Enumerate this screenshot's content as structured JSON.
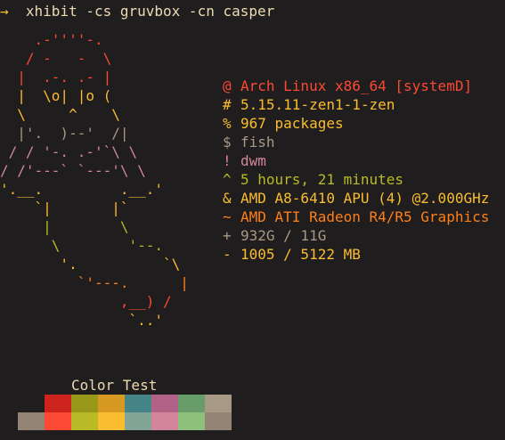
{
  "prompt": {
    "arrow": "→",
    "command": "xhibit -cs gruvbox -cn casper"
  },
  "art": {
    "lines": [
      {
        "text": "    .-''''-.",
        "color": "#fb4934"
      },
      {
        "text": "   / -   -  \\",
        "color": "#fb4934"
      },
      {
        "text": "  |  .-. .- |",
        "color": "#fb4934"
      },
      {
        "text": "  |  \\o| |o (",
        "color": "#fabd2f"
      },
      {
        "text": "  \\     ^    \\",
        "color": "#fabd2f"
      },
      {
        "text": "  |'.  )--'  /|",
        "color": "#a89984"
      },
      {
        "text": " / / '-. .-'`\\ \\",
        "color": "#d3869b"
      },
      {
        "text": "/ /'---` `---'\\ \\",
        "color": "#d3869b"
      },
      {
        "text": "'.__.         .__.'",
        "color": "#fabd2f"
      },
      {
        "text": "    `|       |`",
        "color": "#fabd2f"
      },
      {
        "text": "     |        \\",
        "color": "#b8bb26"
      },
      {
        "text": "      \\        '--.",
        "color": "#b8bb26"
      },
      {
        "text": "       '.          `\\",
        "color": "#fabd2f"
      },
      {
        "text": "         `'---.      |",
        "color": "#fe8019"
      },
      {
        "text": "              ,__) /",
        "color": "#fb4934"
      },
      {
        "text": "               `..'",
        "color": "#fabd2f"
      }
    ]
  },
  "info": [
    {
      "symbol": "@",
      "text": "Arch Linux x86_64 [systemD]",
      "color": "#fb4934"
    },
    {
      "symbol": "#",
      "text": "5.15.11-zen1-1-zen",
      "color": "#fabd2f"
    },
    {
      "symbol": "%",
      "text": "967 packages",
      "color": "#fabd2f"
    },
    {
      "symbol": "$",
      "text": "fish",
      "color": "#a89984"
    },
    {
      "symbol": "!",
      "text": "dwm",
      "color": "#d3869b"
    },
    {
      "symbol": "^",
      "text": "5 hours, 21 minutes",
      "color": "#b8bb26"
    },
    {
      "symbol": "&",
      "text": "AMD A8-6410 APU (4) @2.000GHz",
      "color": "#fabd2f"
    },
    {
      "symbol": "~",
      "text": "AMD ATI Radeon R4/R5 Graphics",
      "color": "#fe8019"
    },
    {
      "symbol": "+",
      "text": "932G / 11G",
      "color": "#a89984"
    },
    {
      "symbol": "-",
      "text": "1005 / 5122 MB",
      "color": "#fabd2f"
    }
  ],
  "color_test": {
    "title": "Color Test",
    "row1": [
      "#cc241d",
      "#98971a",
      "#d79921",
      "#458588",
      "#b16286",
      "#689d6a",
      "#a89984"
    ],
    "row2": [
      "#928374",
      "#fb4934",
      "#b8bb26",
      "#fabd2f",
      "#83a598",
      "#d3869b",
      "#8ec07c",
      "#928374"
    ]
  }
}
